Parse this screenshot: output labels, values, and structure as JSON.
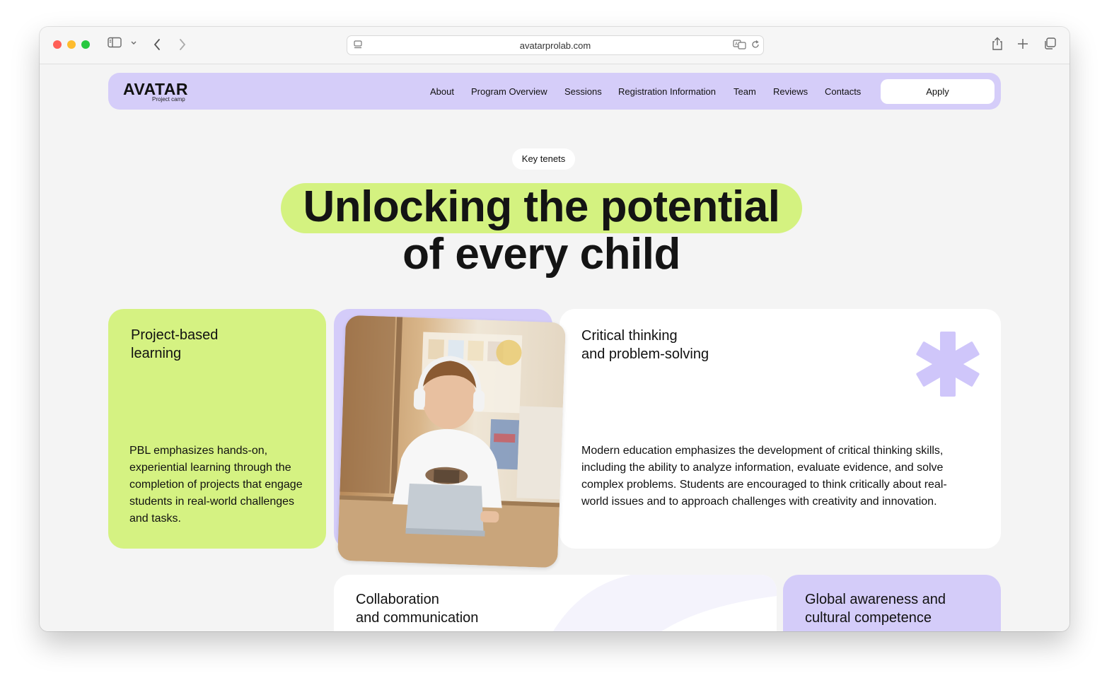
{
  "browser": {
    "url": "avatarprolab.com"
  },
  "nav": {
    "logo": "AVATAR",
    "logo_sub": "Project camp",
    "links": [
      "About",
      "Program Overview",
      "Sessions",
      "Registration Information",
      "Team",
      "Reviews",
      "Contacts"
    ],
    "apply_label": "Apply"
  },
  "hero": {
    "pill": "Key tenets",
    "line1": "Unlocking the potential",
    "line2": "of every child"
  },
  "cards": {
    "pbl": {
      "title": "Project-based\nlearning",
      "text": "PBL emphasizes hands-on, experiential learning through the completion of projects that engage students in real-world challenges and tasks."
    },
    "critical": {
      "title": "Critical thinking\nand problem-solving",
      "text": "Modern education emphasizes the development of critical thinking skills, including the ability to analyze information, evaluate evidence, and solve complex problems. Students are encouraged to think critically about real-world issues and to approach challenges with creativity and innovation."
    },
    "collab": {
      "title": "Collaboration\nand communication"
    },
    "global": {
      "title": "Global awareness and\ncultural competence"
    }
  },
  "colors": {
    "accent_green": "#d5f282",
    "accent_purple": "#d4ccf9",
    "page_bg": "#f4f4f4"
  },
  "icons": [
    "sidebar-icon",
    "chevron-down-icon",
    "back-icon",
    "forward-icon",
    "page-icon",
    "translate-icon",
    "reload-icon",
    "share-icon",
    "new-tab-icon",
    "tabs-icon",
    "asterisk-icon"
  ]
}
